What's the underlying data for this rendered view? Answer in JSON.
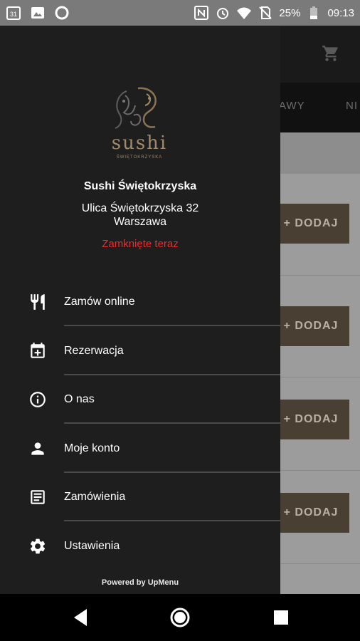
{
  "status_bar": {
    "battery": "25%",
    "time": "09:13",
    "calendar_day": "31",
    "icons": [
      "calendar-icon",
      "image-icon",
      "circle-icon",
      "nfc-icon",
      "alarm-icon",
      "wifi-icon",
      "no-sim-icon",
      "battery-icon"
    ]
  },
  "background": {
    "tabs": [
      "TAWY",
      "NI"
    ],
    "add_buttons": [
      "+ DODAJ",
      "+ DODAJ",
      "+ DODAJ",
      "+ DODAJ"
    ],
    "cart_icon": "cart-icon"
  },
  "drawer": {
    "logo_text": "sushi",
    "logo_subtitle": "ŚWIĘTOKRZYSKA",
    "restaurant_name": "Sushi Świętokrzyska",
    "street": "Ulica Świętokrzyska 32",
    "city": "Warszawa",
    "status": "Zamknięte teraz",
    "status_color": "#e03030",
    "items": [
      {
        "label": "Zamów online",
        "icon": "restaurant-icon"
      },
      {
        "label": "Rezerwacja",
        "icon": "calendar-add-icon"
      },
      {
        "label": "O nas",
        "icon": "info-icon"
      },
      {
        "label": "Moje konto",
        "icon": "person-icon"
      },
      {
        "label": "Zamówienia",
        "icon": "orders-icon"
      },
      {
        "label": "Ustawienia",
        "icon": "settings-icon"
      }
    ],
    "powered_by": "Powered by UpMenu"
  },
  "nav_bar": {
    "buttons": [
      "back-icon",
      "home-icon",
      "recents-icon"
    ]
  },
  "colors": {
    "drawer_bg": "#1e1e1f",
    "accent_brown": "#4a3f33",
    "logo_gold": "#a08a6a"
  }
}
